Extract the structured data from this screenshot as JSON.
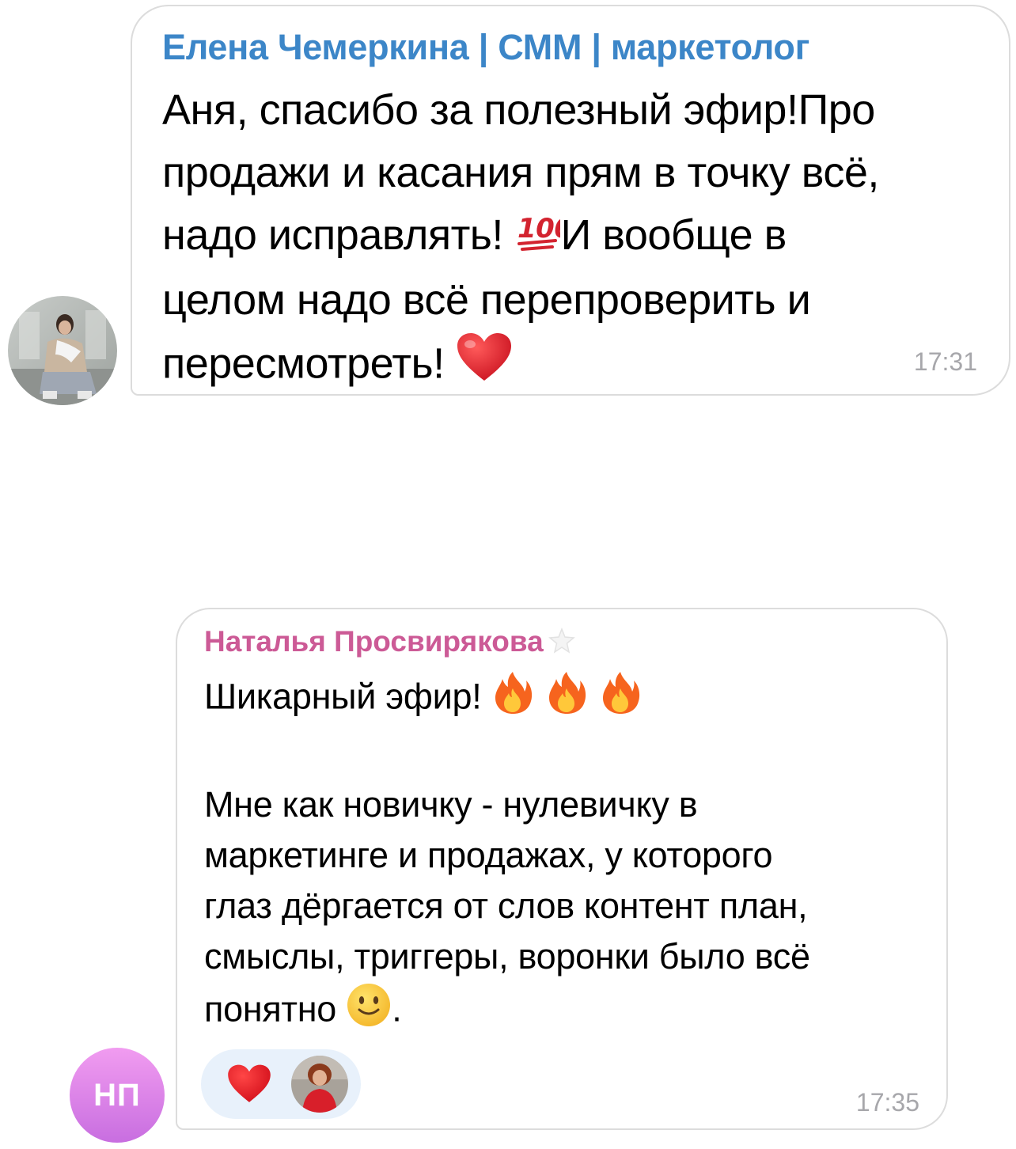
{
  "colors": {
    "sender1": "#3c86c8",
    "sender2": "#cc5a96",
    "timestamp": "#a7a7ab",
    "reaction_bg": "#e8f1fb",
    "avatar2_gradient_start": "#f19cf0",
    "avatar2_gradient_end": "#c86ee0"
  },
  "messages": [
    {
      "sender": "Елена Чемеркина | СММ | маркетолог",
      "lines": [
        "Аня, спасибо за полезный эфир!Про",
        "продажи и касания прям в точку всё,",
        "надо исправлять! ",
        "И вообще в",
        "целом надо всё перепроверить и",
        "пересмотреть! "
      ],
      "emoji": [
        "hundred-points-icon",
        "red-heart-icon"
      ],
      "time": "17:31",
      "avatar": "photo-avatar"
    },
    {
      "sender": "Наталья Просвирякова",
      "sender_badge": "star-icon",
      "lines": [
        "Шикарный эфир! ",
        "",
        "Мне как новичку - нулевичку в",
        "маркетинге и продажах, у которого",
        "глаз дёргается от слов контент план,",
        "смыслы, триггеры, воронки было всё",
        "понятно ",
        "."
      ],
      "emoji": [
        "fire-icon",
        "fire-icon",
        "fire-icon",
        "slightly-smiling-face-icon"
      ],
      "time": "17:35",
      "avatar_initials": "НП",
      "reactions": [
        {
          "icon": "red-heart-icon",
          "by": "photo-avatar"
        }
      ]
    }
  ]
}
